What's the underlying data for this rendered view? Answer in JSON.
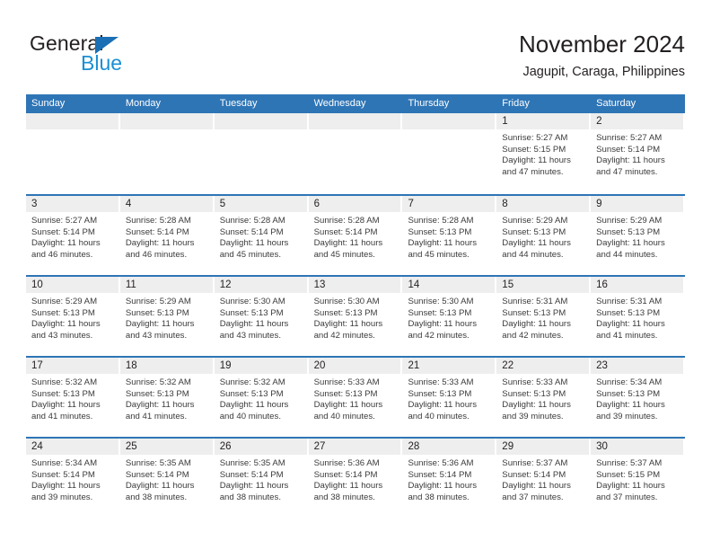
{
  "brand": {
    "name_part1": "General",
    "name_part2": "Blue",
    "triangle_color": "#1b6fb4",
    "blue_color": "#1b8fd4"
  },
  "header": {
    "title": "November 2024",
    "subtitle": "Jagupit, Caraga, Philippines"
  },
  "colors": {
    "header_blue": "#2e75b6",
    "day_band_gray": "#eeeeee",
    "text": "#231f20"
  },
  "weekdays": [
    "Sunday",
    "Monday",
    "Tuesday",
    "Wednesday",
    "Thursday",
    "Friday",
    "Saturday"
  ],
  "labels": {
    "sunrise": "Sunrise:",
    "sunset": "Sunset:",
    "daylight": "Daylight:"
  },
  "weeks": [
    [
      {
        "day": "",
        "sunrise": "",
        "sunset": "",
        "daylight_line1": "",
        "daylight_line2": ""
      },
      {
        "day": "",
        "sunrise": "",
        "sunset": "",
        "daylight_line1": "",
        "daylight_line2": ""
      },
      {
        "day": "",
        "sunrise": "",
        "sunset": "",
        "daylight_line1": "",
        "daylight_line2": ""
      },
      {
        "day": "",
        "sunrise": "",
        "sunset": "",
        "daylight_line1": "",
        "daylight_line2": ""
      },
      {
        "day": "",
        "sunrise": "",
        "sunset": "",
        "daylight_line1": "",
        "daylight_line2": ""
      },
      {
        "day": "1",
        "sunrise": "Sunrise: 5:27 AM",
        "sunset": "Sunset: 5:15 PM",
        "daylight_line1": "Daylight: 11 hours",
        "daylight_line2": "and 47 minutes."
      },
      {
        "day": "2",
        "sunrise": "Sunrise: 5:27 AM",
        "sunset": "Sunset: 5:14 PM",
        "daylight_line1": "Daylight: 11 hours",
        "daylight_line2": "and 47 minutes."
      }
    ],
    [
      {
        "day": "3",
        "sunrise": "Sunrise: 5:27 AM",
        "sunset": "Sunset: 5:14 PM",
        "daylight_line1": "Daylight: 11 hours",
        "daylight_line2": "and 46 minutes."
      },
      {
        "day": "4",
        "sunrise": "Sunrise: 5:28 AM",
        "sunset": "Sunset: 5:14 PM",
        "daylight_line1": "Daylight: 11 hours",
        "daylight_line2": "and 46 minutes."
      },
      {
        "day": "5",
        "sunrise": "Sunrise: 5:28 AM",
        "sunset": "Sunset: 5:14 PM",
        "daylight_line1": "Daylight: 11 hours",
        "daylight_line2": "and 45 minutes."
      },
      {
        "day": "6",
        "sunrise": "Sunrise: 5:28 AM",
        "sunset": "Sunset: 5:14 PM",
        "daylight_line1": "Daylight: 11 hours",
        "daylight_line2": "and 45 minutes."
      },
      {
        "day": "7",
        "sunrise": "Sunrise: 5:28 AM",
        "sunset": "Sunset: 5:13 PM",
        "daylight_line1": "Daylight: 11 hours",
        "daylight_line2": "and 45 minutes."
      },
      {
        "day": "8",
        "sunrise": "Sunrise: 5:29 AM",
        "sunset": "Sunset: 5:13 PM",
        "daylight_line1": "Daylight: 11 hours",
        "daylight_line2": "and 44 minutes."
      },
      {
        "day": "9",
        "sunrise": "Sunrise: 5:29 AM",
        "sunset": "Sunset: 5:13 PM",
        "daylight_line1": "Daylight: 11 hours",
        "daylight_line2": "and 44 minutes."
      }
    ],
    [
      {
        "day": "10",
        "sunrise": "Sunrise: 5:29 AM",
        "sunset": "Sunset: 5:13 PM",
        "daylight_line1": "Daylight: 11 hours",
        "daylight_line2": "and 43 minutes."
      },
      {
        "day": "11",
        "sunrise": "Sunrise: 5:29 AM",
        "sunset": "Sunset: 5:13 PM",
        "daylight_line1": "Daylight: 11 hours",
        "daylight_line2": "and 43 minutes."
      },
      {
        "day": "12",
        "sunrise": "Sunrise: 5:30 AM",
        "sunset": "Sunset: 5:13 PM",
        "daylight_line1": "Daylight: 11 hours",
        "daylight_line2": "and 43 minutes."
      },
      {
        "day": "13",
        "sunrise": "Sunrise: 5:30 AM",
        "sunset": "Sunset: 5:13 PM",
        "daylight_line1": "Daylight: 11 hours",
        "daylight_line2": "and 42 minutes."
      },
      {
        "day": "14",
        "sunrise": "Sunrise: 5:30 AM",
        "sunset": "Sunset: 5:13 PM",
        "daylight_line1": "Daylight: 11 hours",
        "daylight_line2": "and 42 minutes."
      },
      {
        "day": "15",
        "sunrise": "Sunrise: 5:31 AM",
        "sunset": "Sunset: 5:13 PM",
        "daylight_line1": "Daylight: 11 hours",
        "daylight_line2": "and 42 minutes."
      },
      {
        "day": "16",
        "sunrise": "Sunrise: 5:31 AM",
        "sunset": "Sunset: 5:13 PM",
        "daylight_line1": "Daylight: 11 hours",
        "daylight_line2": "and 41 minutes."
      }
    ],
    [
      {
        "day": "17",
        "sunrise": "Sunrise: 5:32 AM",
        "sunset": "Sunset: 5:13 PM",
        "daylight_line1": "Daylight: 11 hours",
        "daylight_line2": "and 41 minutes."
      },
      {
        "day": "18",
        "sunrise": "Sunrise: 5:32 AM",
        "sunset": "Sunset: 5:13 PM",
        "daylight_line1": "Daylight: 11 hours",
        "daylight_line2": "and 41 minutes."
      },
      {
        "day": "19",
        "sunrise": "Sunrise: 5:32 AM",
        "sunset": "Sunset: 5:13 PM",
        "daylight_line1": "Daylight: 11 hours",
        "daylight_line2": "and 40 minutes."
      },
      {
        "day": "20",
        "sunrise": "Sunrise: 5:33 AM",
        "sunset": "Sunset: 5:13 PM",
        "daylight_line1": "Daylight: 11 hours",
        "daylight_line2": "and 40 minutes."
      },
      {
        "day": "21",
        "sunrise": "Sunrise: 5:33 AM",
        "sunset": "Sunset: 5:13 PM",
        "daylight_line1": "Daylight: 11 hours",
        "daylight_line2": "and 40 minutes."
      },
      {
        "day": "22",
        "sunrise": "Sunrise: 5:33 AM",
        "sunset": "Sunset: 5:13 PM",
        "daylight_line1": "Daylight: 11 hours",
        "daylight_line2": "and 39 minutes."
      },
      {
        "day": "23",
        "sunrise": "Sunrise: 5:34 AM",
        "sunset": "Sunset: 5:13 PM",
        "daylight_line1": "Daylight: 11 hours",
        "daylight_line2": "and 39 minutes."
      }
    ],
    [
      {
        "day": "24",
        "sunrise": "Sunrise: 5:34 AM",
        "sunset": "Sunset: 5:14 PM",
        "daylight_line1": "Daylight: 11 hours",
        "daylight_line2": "and 39 minutes."
      },
      {
        "day": "25",
        "sunrise": "Sunrise: 5:35 AM",
        "sunset": "Sunset: 5:14 PM",
        "daylight_line1": "Daylight: 11 hours",
        "daylight_line2": "and 38 minutes."
      },
      {
        "day": "26",
        "sunrise": "Sunrise: 5:35 AM",
        "sunset": "Sunset: 5:14 PM",
        "daylight_line1": "Daylight: 11 hours",
        "daylight_line2": "and 38 minutes."
      },
      {
        "day": "27",
        "sunrise": "Sunrise: 5:36 AM",
        "sunset": "Sunset: 5:14 PM",
        "daylight_line1": "Daylight: 11 hours",
        "daylight_line2": "and 38 minutes."
      },
      {
        "day": "28",
        "sunrise": "Sunrise: 5:36 AM",
        "sunset": "Sunset: 5:14 PM",
        "daylight_line1": "Daylight: 11 hours",
        "daylight_line2": "and 38 minutes."
      },
      {
        "day": "29",
        "sunrise": "Sunrise: 5:37 AM",
        "sunset": "Sunset: 5:14 PM",
        "daylight_line1": "Daylight: 11 hours",
        "daylight_line2": "and 37 minutes."
      },
      {
        "day": "30",
        "sunrise": "Sunrise: 5:37 AM",
        "sunset": "Sunset: 5:15 PM",
        "daylight_line1": "Daylight: 11 hours",
        "daylight_line2": "and 37 minutes."
      }
    ]
  ]
}
